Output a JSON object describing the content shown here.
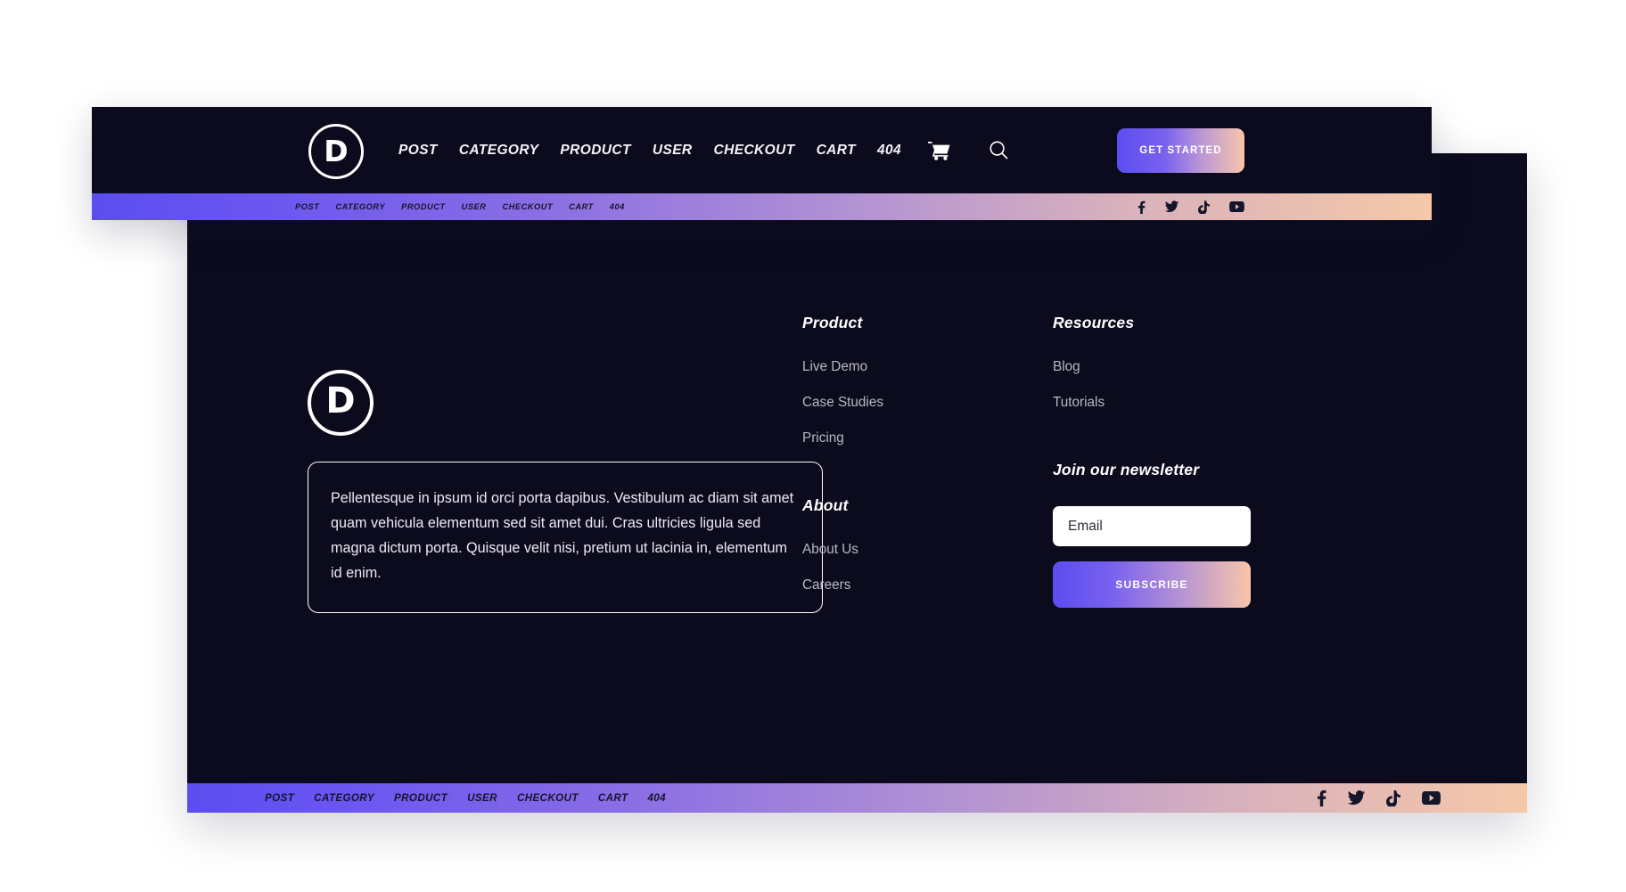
{
  "header": {
    "logo_letter": "D",
    "logo_icon": "divi-logo-icon",
    "nav_items": [
      {
        "label": "POST"
      },
      {
        "label": "CATEGORY"
      },
      {
        "label": "PRODUCT"
      },
      {
        "label": "USER"
      },
      {
        "label": "CHECKOUT"
      },
      {
        "label": "CART"
      },
      {
        "label": "404"
      }
    ],
    "cart_icon": "shopping-cart-icon",
    "search_icon": "search-icon",
    "cta_label": "GET STARTED"
  },
  "header_gradient_bar": {
    "nav_items": [
      {
        "label": "POST"
      },
      {
        "label": "CATEGORY"
      },
      {
        "label": "PRODUCT"
      },
      {
        "label": "USER"
      },
      {
        "label": "CHECKOUT"
      },
      {
        "label": "CART"
      },
      {
        "label": "404"
      }
    ],
    "social": [
      {
        "name": "facebook-icon"
      },
      {
        "name": "twitter-icon"
      },
      {
        "name": "tiktok-icon"
      },
      {
        "name": "youtube-icon"
      }
    ]
  },
  "footer": {
    "logo_letter": "D",
    "blurb": "Pellentesque in ipsum id orci porta dapibus. Vestibulum ac diam sit amet quam vehicula elementum sed sit amet dui. Cras ultricies ligula sed magna dictum porta. Quisque velit nisi, pretium ut lacinia in, elementum id enim.",
    "product": {
      "heading": "Product",
      "links": [
        {
          "label": "Live Demo"
        },
        {
          "label": "Case Studies"
        },
        {
          "label": "Pricing"
        }
      ]
    },
    "about": {
      "heading": "About",
      "links": [
        {
          "label": "About Us"
        },
        {
          "label": "Careers"
        }
      ]
    },
    "resources": {
      "heading": "Resources",
      "links": [
        {
          "label": "Blog"
        },
        {
          "label": "Tutorials"
        }
      ]
    },
    "newsletter": {
      "heading": "Join our newsletter",
      "email_placeholder": "Email",
      "email_value": "",
      "subscribe_label": "SUBSCRIBE"
    },
    "bottom_bar": {
      "nav_items": [
        {
          "label": "POST"
        },
        {
          "label": "CATEGORY"
        },
        {
          "label": "PRODUCT"
        },
        {
          "label": "USER"
        },
        {
          "label": "CHECKOUT"
        },
        {
          "label": "CART"
        },
        {
          "label": "404"
        }
      ],
      "social": [
        {
          "name": "facebook-icon"
        },
        {
          "name": "twitter-icon"
        },
        {
          "name": "tiktok-icon"
        },
        {
          "name": "youtube-icon"
        }
      ]
    }
  },
  "colors": {
    "background": "#0b0b1d",
    "page": "#ffffff",
    "gradient_start": "#5b4df0",
    "gradient_end": "#f5c8a8",
    "link_muted": "#b9b8c6",
    "text_light": "#ffffff"
  }
}
